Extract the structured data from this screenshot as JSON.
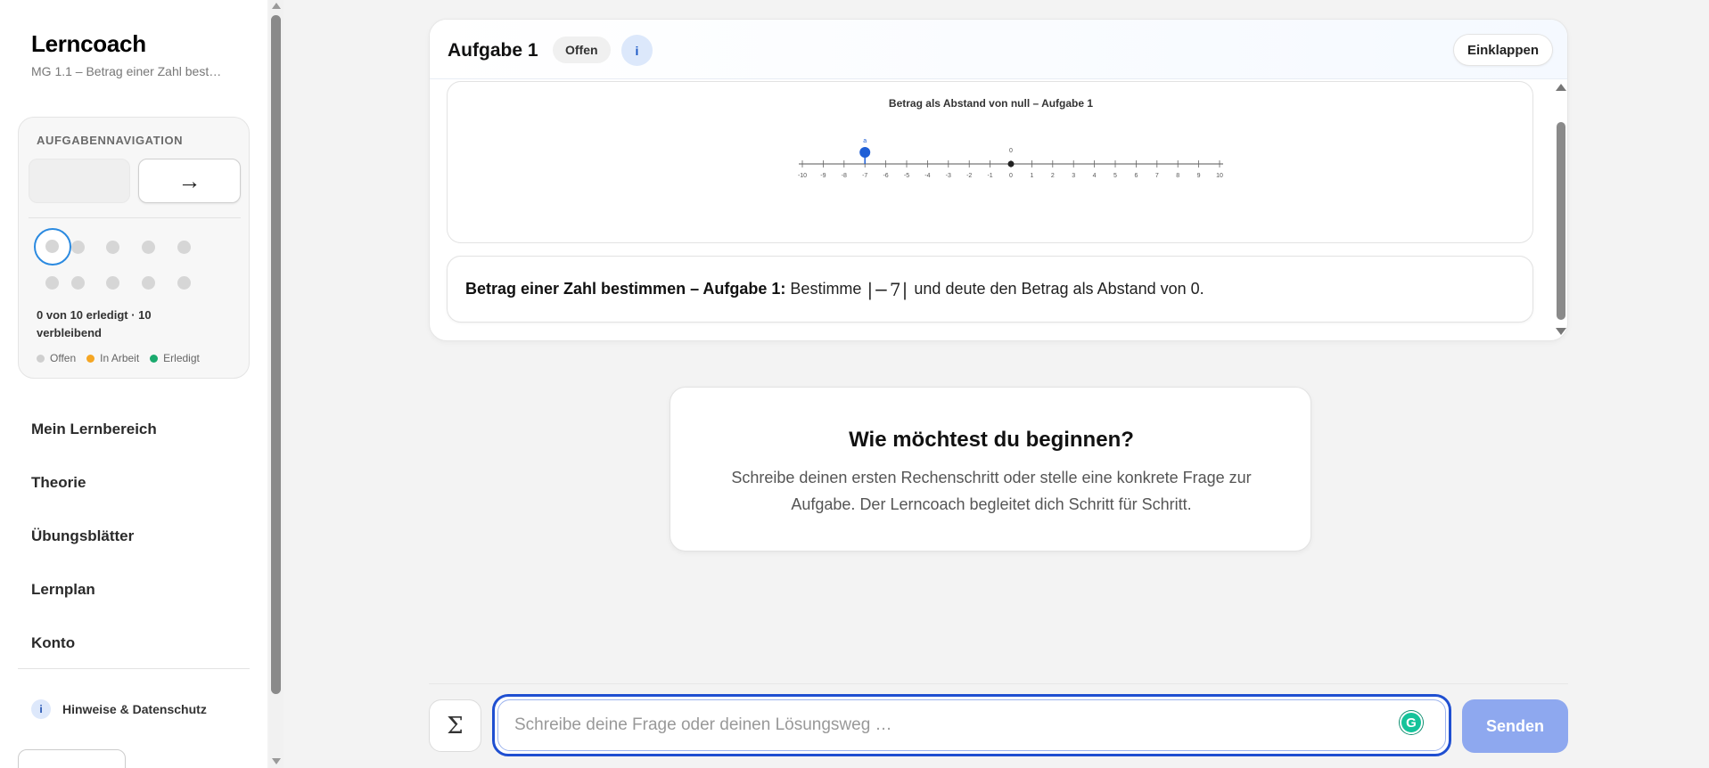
{
  "sidebar": {
    "title": "Lerncoach",
    "subtitle": "MG 1.1 – Betrag einer Zahl best…",
    "nav_card": {
      "title": "AUFGABENNAVIGATION",
      "next_arrow": "→",
      "progress": "0 von 10 erledigt · 10 verbleibend",
      "legend": [
        {
          "label": "Offen",
          "color": "#cfcfcf"
        },
        {
          "label": "In Arbeit",
          "color": "#f5a623"
        },
        {
          "label": "Erledigt",
          "color": "#1aaa6e"
        }
      ],
      "task_count": 10,
      "current_task": 1
    },
    "links": [
      "Mein Lernbereich",
      "Theorie",
      "Übungsblätter",
      "Lernplan",
      "Konto"
    ],
    "info_icon": "i",
    "info_label": "Hinweise & Datenschutz"
  },
  "task": {
    "title": "Aufgabe 1",
    "status": "Offen",
    "info_icon": "i",
    "collapse_label": "Einklappen",
    "figure": {
      "title": "Betrag als Abstand von null – Aufgabe 1",
      "axis_min": -10,
      "axis_max": 10,
      "ticks": [
        "-10",
        "-9",
        "-8",
        "-7",
        "-6",
        "-5",
        "-4",
        "-3",
        "-2",
        "-1",
        "0",
        "1",
        "2",
        "3",
        "4",
        "5",
        "6",
        "7",
        "8",
        "9",
        "10"
      ],
      "point_value": -7,
      "point_label": "a",
      "origin_label": "0",
      "point_color": "#1f5fd6"
    },
    "question_bold": "Betrag einer Zahl bestimmen – Aufgabe 1:",
    "question_pre": "Bestimme",
    "question_math": "|−7|",
    "question_post": "und deute den Betrag als Abstand von 0."
  },
  "start": {
    "title": "Wie möchtest du beginnen?",
    "text": "Schreibe deinen ersten Rechenschritt oder stelle eine konkrete Frage zur Aufgabe. Der Lerncoach begleitet dich Schritt für Schritt."
  },
  "composer": {
    "sigma": "Σ",
    "placeholder": "Schreibe deine Frage oder deinen Lösungsweg …",
    "grammarly_icon": "G",
    "send_label": "Senden"
  },
  "colors": {
    "accent": "#1f4fd1",
    "send_button": "#8ea8ef",
    "active_ring": "#2b8ae0"
  }
}
